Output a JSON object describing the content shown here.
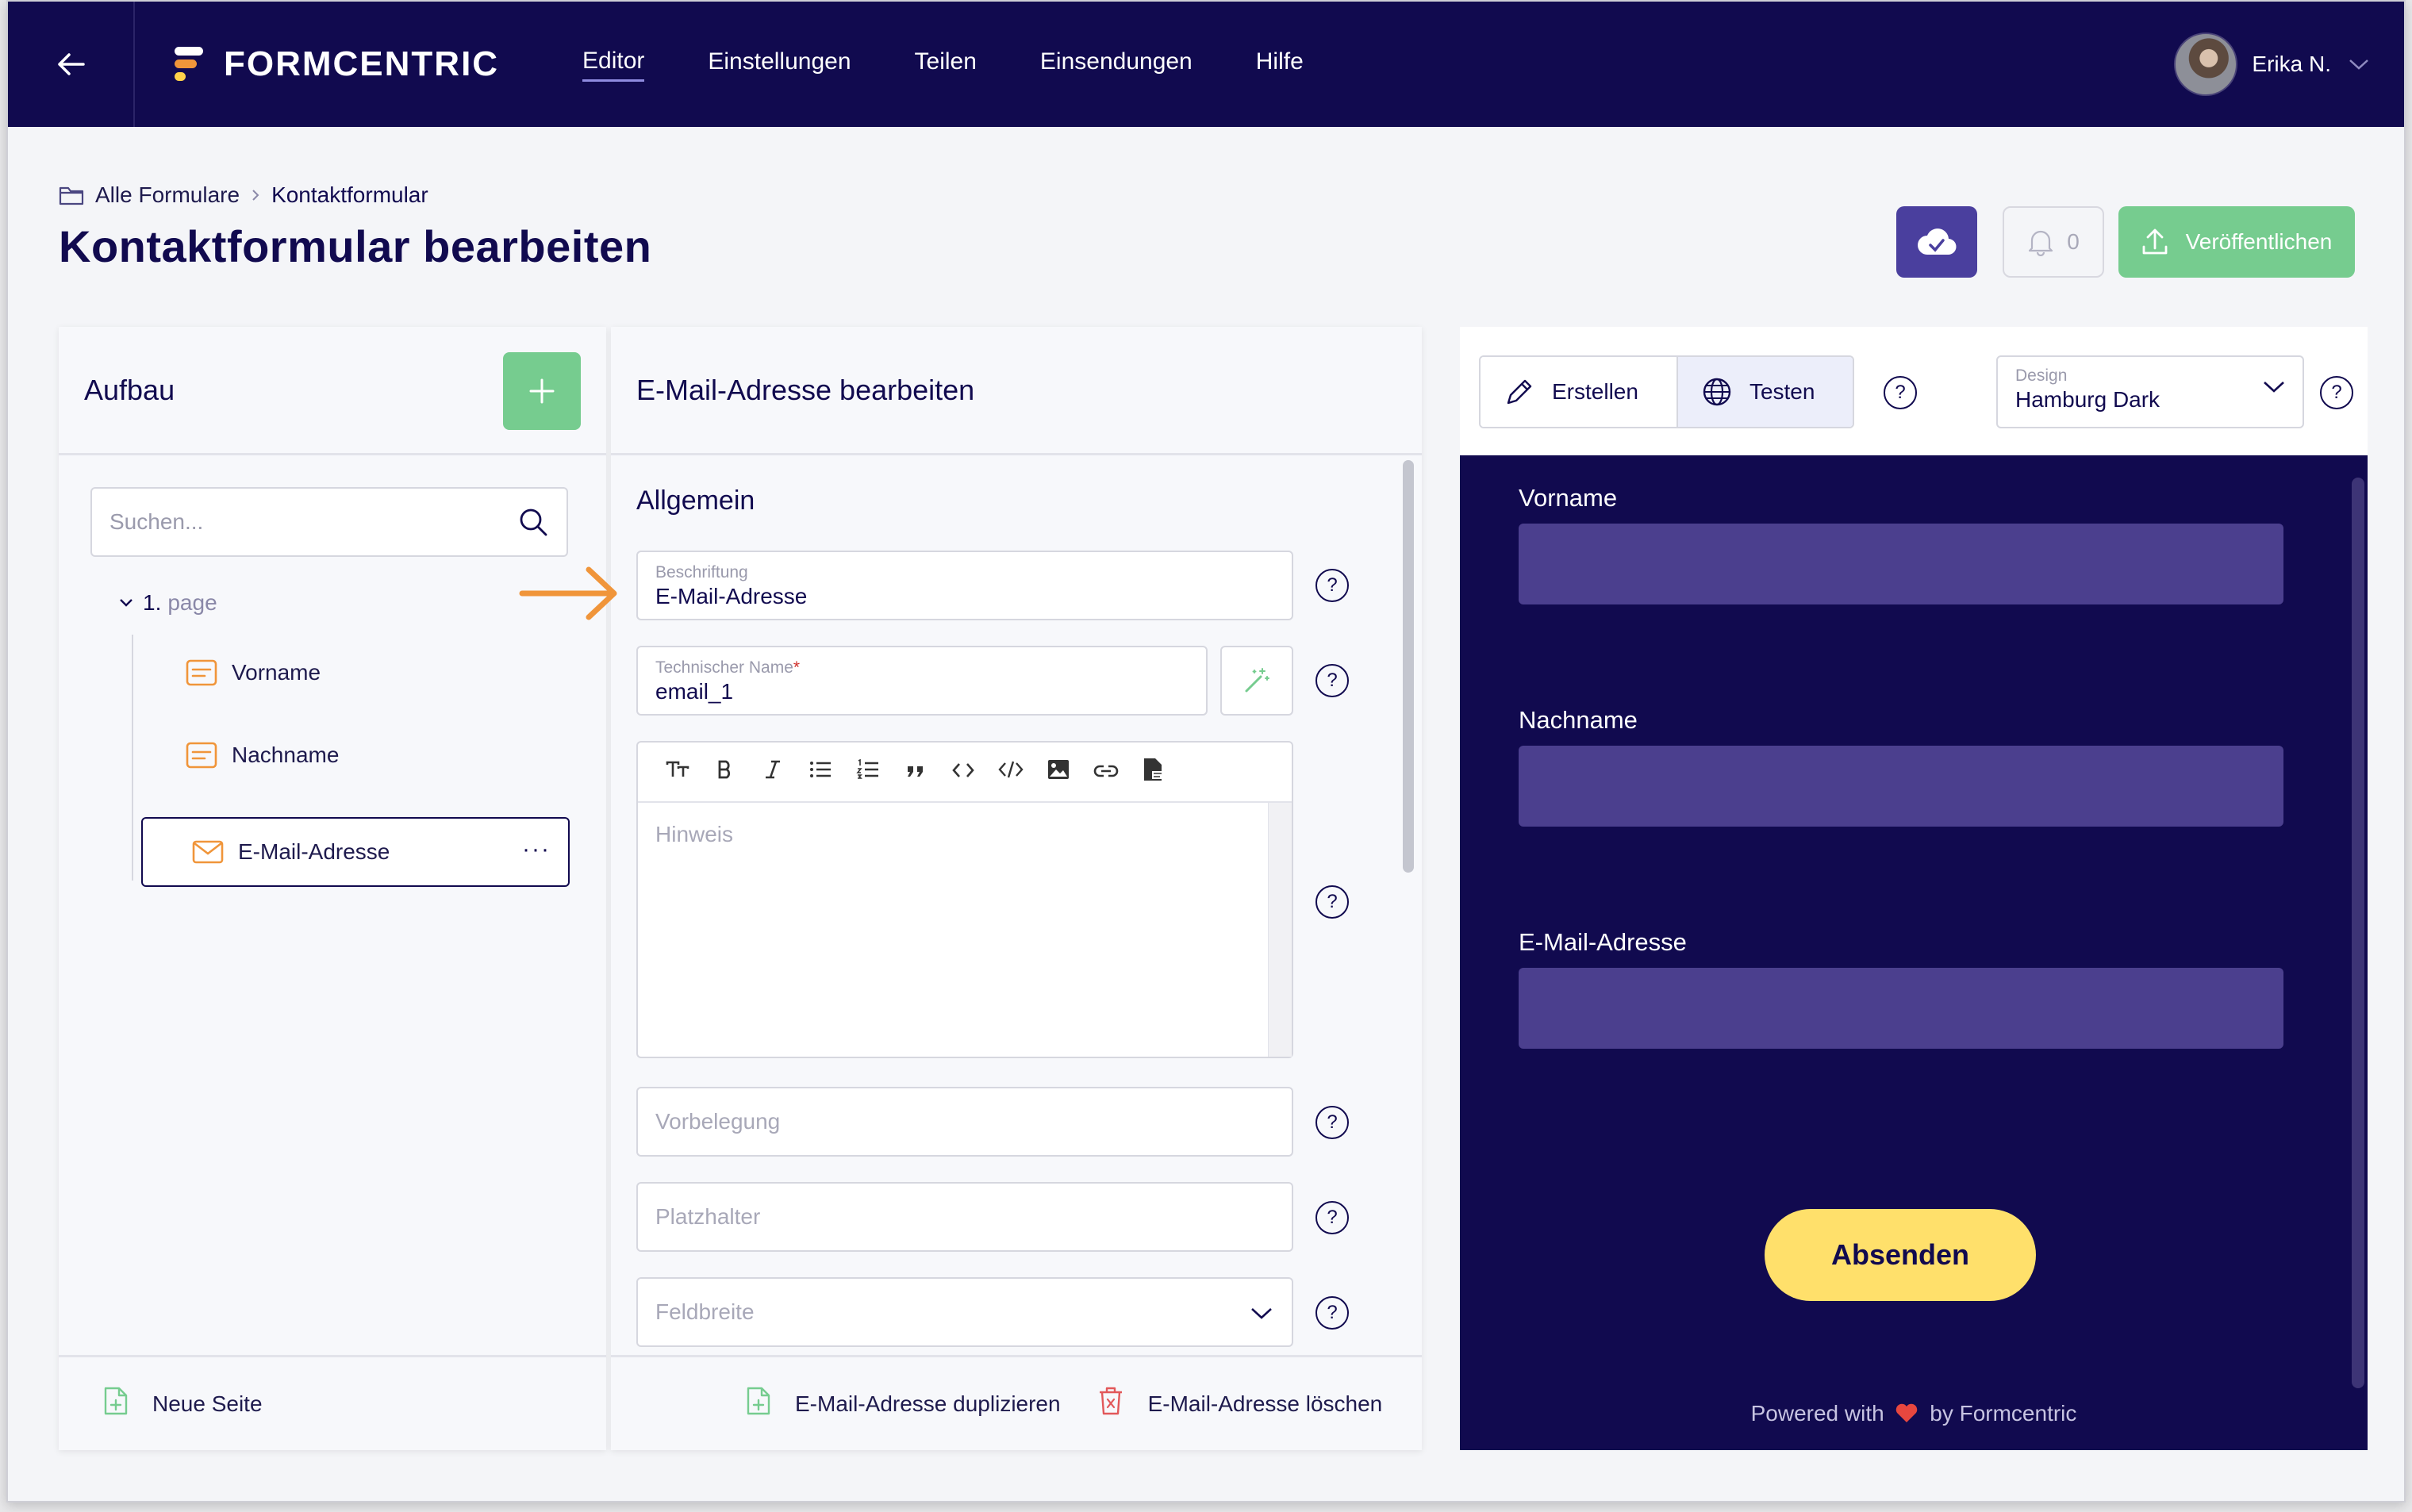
{
  "nav": {
    "brand": "FORMCENTRIC",
    "items": [
      "Editor",
      "Einstellungen",
      "Teilen",
      "Einsendungen",
      "Hilfe"
    ],
    "user_name": "Erika N."
  },
  "breadcrumb": {
    "root": "Alle Formulare",
    "current": "Kontaktformular"
  },
  "page_title": "Kontaktformular bearbeiten",
  "header_actions": {
    "notifications_count": "0",
    "publish_label": "Veröffentlichen"
  },
  "structure": {
    "title": "Aufbau",
    "search_placeholder": "Suchen...",
    "page_number": "1.",
    "page_label": "page",
    "items": [
      {
        "label": "Vorname"
      },
      {
        "label": "Nachname"
      },
      {
        "label": "E-Mail-Adresse"
      }
    ],
    "more_label": "···",
    "new_page_label": "Neue Seite"
  },
  "field_editor": {
    "title": "E-Mail-Adresse bearbeiten",
    "section": "Allgemein",
    "caption_label": "Beschriftung",
    "caption_value": "E-Mail-Adresse",
    "technical_name_label": "Technischer Name",
    "technical_name_required": "*",
    "technical_name_value": "email_1",
    "hint_placeholder": "Hinweis",
    "default_placeholder": "Vorbelegung",
    "placeholder_placeholder": "Platzhalter",
    "width_placeholder": "Feldbreite",
    "duplicate_label": "E-Mail-Adresse duplizieren",
    "delete_label": "E-Mail-Adresse löschen",
    "help_symbol": "?"
  },
  "preview": {
    "create_tab": "Erstellen",
    "test_tab": "Testen",
    "design_label": "Design",
    "design_value": "Hamburg Dark",
    "fields": [
      "Vorname",
      "Nachname",
      "E-Mail-Adresse"
    ],
    "submit_label": "Absenden",
    "powered_prefix": "Powered with",
    "powered_suffix": "by Formcentric"
  },
  "colors": {
    "navy": "#110a4f",
    "accent_green": "#76cc8f",
    "purple_button": "#4a3f9e",
    "preview_input": "#4b3f8e",
    "submit_yellow": "#ffe06b",
    "orange_icon": "#f0953a"
  }
}
